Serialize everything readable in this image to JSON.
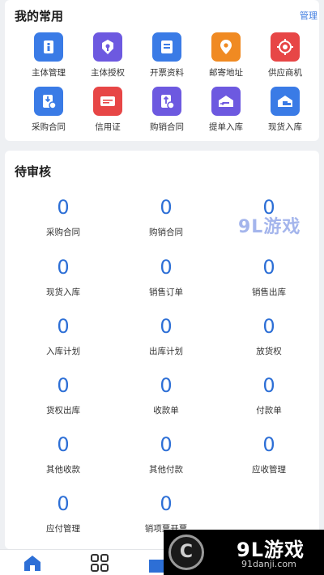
{
  "favorites": {
    "title": "我的常用",
    "manage_label": "管理",
    "items": [
      {
        "label": "主体管理",
        "icon": "id-card-icon",
        "color": "#3a7be6"
      },
      {
        "label": "主体授权",
        "icon": "authorization-icon",
        "color": "#6d59e0"
      },
      {
        "label": "开票资料",
        "icon": "invoice-info-icon",
        "color": "#3a7be6"
      },
      {
        "label": "邮寄地址",
        "icon": "location-pin-icon",
        "color": "#f08a22"
      },
      {
        "label": "供应商机",
        "icon": "target-icon",
        "color": "#e74646"
      },
      {
        "label": "采购合同",
        "icon": "purchase-contract-icon",
        "color": "#3a7be6"
      },
      {
        "label": "信用证",
        "icon": "credit-card-icon",
        "color": "#e74646"
      },
      {
        "label": "购销合同",
        "icon": "sales-contract-icon",
        "color": "#6d59e0"
      },
      {
        "label": "提单入库",
        "icon": "bill-inbound-icon",
        "color": "#6d59e0"
      },
      {
        "label": "现货入库",
        "icon": "spot-inbound-icon",
        "color": "#3a7be6"
      }
    ]
  },
  "pending": {
    "title": "待审核",
    "items": [
      {
        "count": "0",
        "label": "采购合同"
      },
      {
        "count": "0",
        "label": "购销合同"
      },
      {
        "count": "0",
        "label": ""
      },
      {
        "count": "0",
        "label": "现货入库"
      },
      {
        "count": "0",
        "label": "销售订单"
      },
      {
        "count": "0",
        "label": "销售出库"
      },
      {
        "count": "0",
        "label": "入库计划"
      },
      {
        "count": "0",
        "label": "出库计划"
      },
      {
        "count": "0",
        "label": "放货权"
      },
      {
        "count": "0",
        "label": "货权出库"
      },
      {
        "count": "0",
        "label": "收款单"
      },
      {
        "count": "0",
        "label": "付款单"
      },
      {
        "count": "0",
        "label": "其他收款"
      },
      {
        "count": "0",
        "label": "其他付款"
      },
      {
        "count": "0",
        "label": "应收管理"
      },
      {
        "count": "0",
        "label": "应付管理"
      },
      {
        "count": "0",
        "label": "销项票开票"
      }
    ]
  },
  "tabbar": {
    "tabs": [
      {
        "icon": "home-icon",
        "active": true
      },
      {
        "icon": "grid-icon",
        "active": false
      },
      {
        "icon": "message-icon",
        "active": false
      }
    ],
    "active_color": "#2d6fd6"
  },
  "watermark": {
    "brand": "9L游戏",
    "site": "91danji.com",
    "top_brand": "9L游戏"
  }
}
